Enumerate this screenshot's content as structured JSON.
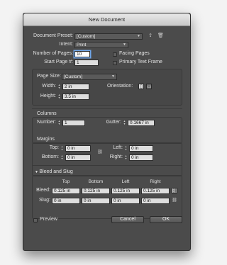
{
  "window": {
    "title": "New Document"
  },
  "top": {
    "document_preset_label": "Document Preset:",
    "document_preset_value": "[Custom]",
    "intent_label": "Intent:",
    "intent_value": "Print",
    "num_pages_label": "Number of Pages:",
    "num_pages_value": "10",
    "start_page_label": "Start Page #:",
    "start_page_value": "1",
    "facing_pages_label": "Facing Pages",
    "primary_text_frame_label": "Primary Text Frame"
  },
  "page_size": {
    "label": "Page Size:",
    "value": "[Custom]",
    "width_label": "Width:",
    "width_value": "2 in",
    "height_label": "Height:",
    "height_value": "3.5 in",
    "orientation_label": "Orientation:"
  },
  "columns": {
    "title": "Columns",
    "number_label": "Number:",
    "number_value": "1",
    "gutter_label": "Gutter:",
    "gutter_value": "0.1667 in"
  },
  "margins": {
    "title": "Margins",
    "top_label": "Top:",
    "top_value": "0 in",
    "bottom_label": "Bottom:",
    "bottom_value": "0 in",
    "left_label": "Left:",
    "left_value": "0 in",
    "right_label": "Right:",
    "right_value": "0 in"
  },
  "bleed_slug": {
    "title": "Bleed and Slug",
    "headers": [
      "Top",
      "Bottom",
      "Left",
      "Right"
    ],
    "bleed_label": "Bleed:",
    "bleed_values": [
      "0.125 in",
      "0.125 in",
      "0.125 in",
      "0.125 in"
    ],
    "slug_label": "Slug:",
    "slug_values": [
      "0 in",
      "0 in",
      "0 in",
      "0 in"
    ]
  },
  "footer": {
    "preview_label": "Preview",
    "cancel_label": "Cancel",
    "ok_label": "OK"
  },
  "icons": {
    "save_preset": "save-preset-icon",
    "delete_preset": "trash-icon",
    "portrait": "portrait-orientation-icon",
    "landscape": "landscape-orientation-icon",
    "chain": "chain-link-icon"
  }
}
